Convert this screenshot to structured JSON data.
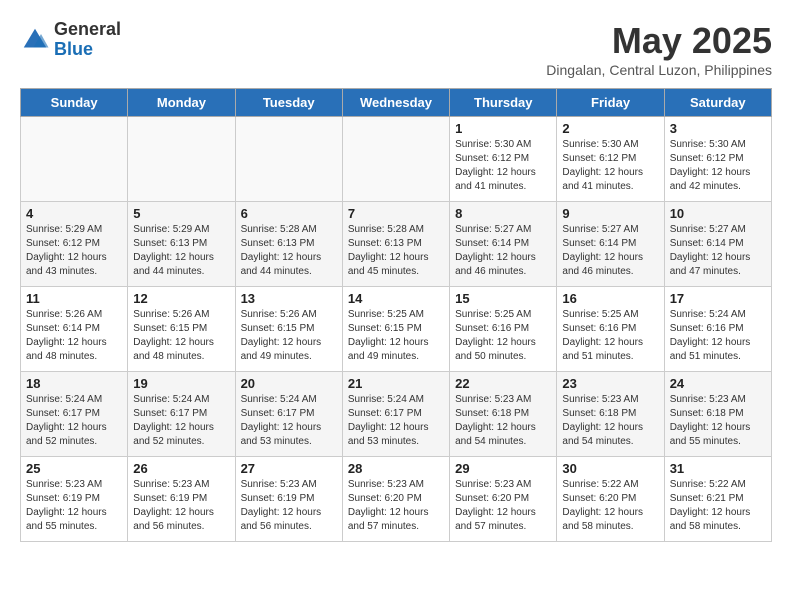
{
  "header": {
    "logo_general": "General",
    "logo_blue": "Blue",
    "month_year": "May 2025",
    "location": "Dingalan, Central Luzon, Philippines"
  },
  "days_of_week": [
    "Sunday",
    "Monday",
    "Tuesday",
    "Wednesday",
    "Thursday",
    "Friday",
    "Saturday"
  ],
  "weeks": [
    [
      {
        "day": "",
        "info": ""
      },
      {
        "day": "",
        "info": ""
      },
      {
        "day": "",
        "info": ""
      },
      {
        "day": "",
        "info": ""
      },
      {
        "day": "1",
        "info": "Sunrise: 5:30 AM\nSunset: 6:12 PM\nDaylight: 12 hours\nand 41 minutes."
      },
      {
        "day": "2",
        "info": "Sunrise: 5:30 AM\nSunset: 6:12 PM\nDaylight: 12 hours\nand 41 minutes."
      },
      {
        "day": "3",
        "info": "Sunrise: 5:30 AM\nSunset: 6:12 PM\nDaylight: 12 hours\nand 42 minutes."
      }
    ],
    [
      {
        "day": "4",
        "info": "Sunrise: 5:29 AM\nSunset: 6:12 PM\nDaylight: 12 hours\nand 43 minutes."
      },
      {
        "day": "5",
        "info": "Sunrise: 5:29 AM\nSunset: 6:13 PM\nDaylight: 12 hours\nand 44 minutes."
      },
      {
        "day": "6",
        "info": "Sunrise: 5:28 AM\nSunset: 6:13 PM\nDaylight: 12 hours\nand 44 minutes."
      },
      {
        "day": "7",
        "info": "Sunrise: 5:28 AM\nSunset: 6:13 PM\nDaylight: 12 hours\nand 45 minutes."
      },
      {
        "day": "8",
        "info": "Sunrise: 5:27 AM\nSunset: 6:14 PM\nDaylight: 12 hours\nand 46 minutes."
      },
      {
        "day": "9",
        "info": "Sunrise: 5:27 AM\nSunset: 6:14 PM\nDaylight: 12 hours\nand 46 minutes."
      },
      {
        "day": "10",
        "info": "Sunrise: 5:27 AM\nSunset: 6:14 PM\nDaylight: 12 hours\nand 47 minutes."
      }
    ],
    [
      {
        "day": "11",
        "info": "Sunrise: 5:26 AM\nSunset: 6:14 PM\nDaylight: 12 hours\nand 48 minutes."
      },
      {
        "day": "12",
        "info": "Sunrise: 5:26 AM\nSunset: 6:15 PM\nDaylight: 12 hours\nand 48 minutes."
      },
      {
        "day": "13",
        "info": "Sunrise: 5:26 AM\nSunset: 6:15 PM\nDaylight: 12 hours\nand 49 minutes."
      },
      {
        "day": "14",
        "info": "Sunrise: 5:25 AM\nSunset: 6:15 PM\nDaylight: 12 hours\nand 49 minutes."
      },
      {
        "day": "15",
        "info": "Sunrise: 5:25 AM\nSunset: 6:16 PM\nDaylight: 12 hours\nand 50 minutes."
      },
      {
        "day": "16",
        "info": "Sunrise: 5:25 AM\nSunset: 6:16 PM\nDaylight: 12 hours\nand 51 minutes."
      },
      {
        "day": "17",
        "info": "Sunrise: 5:24 AM\nSunset: 6:16 PM\nDaylight: 12 hours\nand 51 minutes."
      }
    ],
    [
      {
        "day": "18",
        "info": "Sunrise: 5:24 AM\nSunset: 6:17 PM\nDaylight: 12 hours\nand 52 minutes."
      },
      {
        "day": "19",
        "info": "Sunrise: 5:24 AM\nSunset: 6:17 PM\nDaylight: 12 hours\nand 52 minutes."
      },
      {
        "day": "20",
        "info": "Sunrise: 5:24 AM\nSunset: 6:17 PM\nDaylight: 12 hours\nand 53 minutes."
      },
      {
        "day": "21",
        "info": "Sunrise: 5:24 AM\nSunset: 6:17 PM\nDaylight: 12 hours\nand 53 minutes."
      },
      {
        "day": "22",
        "info": "Sunrise: 5:23 AM\nSunset: 6:18 PM\nDaylight: 12 hours\nand 54 minutes."
      },
      {
        "day": "23",
        "info": "Sunrise: 5:23 AM\nSunset: 6:18 PM\nDaylight: 12 hours\nand 54 minutes."
      },
      {
        "day": "24",
        "info": "Sunrise: 5:23 AM\nSunset: 6:18 PM\nDaylight: 12 hours\nand 55 minutes."
      }
    ],
    [
      {
        "day": "25",
        "info": "Sunrise: 5:23 AM\nSunset: 6:19 PM\nDaylight: 12 hours\nand 55 minutes."
      },
      {
        "day": "26",
        "info": "Sunrise: 5:23 AM\nSunset: 6:19 PM\nDaylight: 12 hours\nand 56 minutes."
      },
      {
        "day": "27",
        "info": "Sunrise: 5:23 AM\nSunset: 6:19 PM\nDaylight: 12 hours\nand 56 minutes."
      },
      {
        "day": "28",
        "info": "Sunrise: 5:23 AM\nSunset: 6:20 PM\nDaylight: 12 hours\nand 57 minutes."
      },
      {
        "day": "29",
        "info": "Sunrise: 5:23 AM\nSunset: 6:20 PM\nDaylight: 12 hours\nand 57 minutes."
      },
      {
        "day": "30",
        "info": "Sunrise: 5:22 AM\nSunset: 6:20 PM\nDaylight: 12 hours\nand 58 minutes."
      },
      {
        "day": "31",
        "info": "Sunrise: 5:22 AM\nSunset: 6:21 PM\nDaylight: 12 hours\nand 58 minutes."
      }
    ]
  ]
}
